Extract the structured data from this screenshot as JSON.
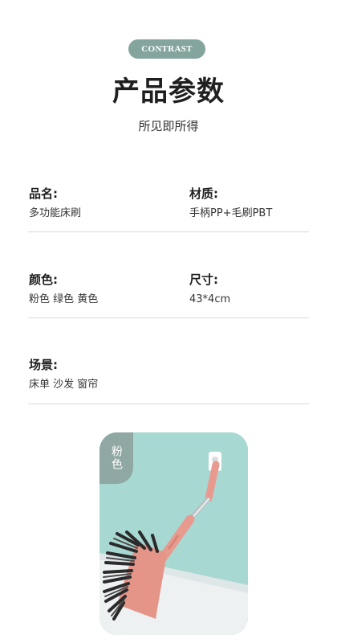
{
  "header": {
    "badge": "CONTRAST",
    "title": "产品参数",
    "subtitle": "所见即所得"
  },
  "specs": {
    "name": {
      "label": "品名:",
      "value": "多功能床刷"
    },
    "material": {
      "label": "材质:",
      "value": "手柄PP+毛刷PBT"
    },
    "color": {
      "label": "颜色:",
      "value": "粉色  绿色  黄色"
    },
    "size": {
      "label": "尺寸:",
      "value": "43*4cm"
    },
    "scene": {
      "label": "场景:",
      "value": "床单  沙发  窗帘"
    }
  },
  "photo": {
    "tag": "粉色",
    "colors": {
      "wall": "#a8d8d2",
      "floor": "#eef1f2",
      "handle": "#e89a8f",
      "bristles": "#2b2b2b",
      "tag_bg": "#8fa8a3"
    }
  },
  "colors": {
    "badge_bg": "#83a59d",
    "divider": "#d9d9d9"
  }
}
